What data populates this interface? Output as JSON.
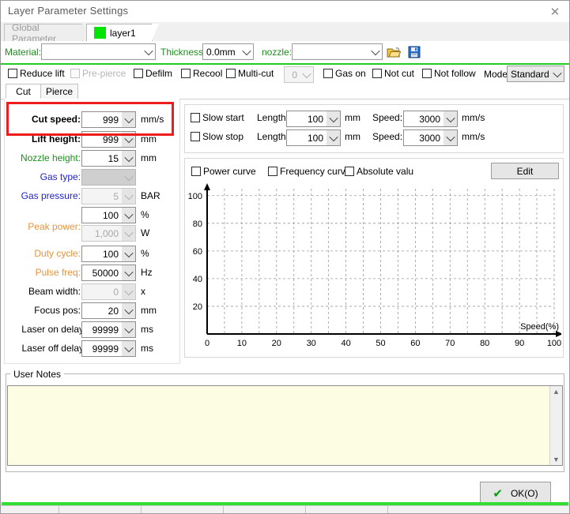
{
  "window": {
    "title": "Layer Parameter Settings",
    "close_icon": "close-icon"
  },
  "param_tabs": [
    {
      "label": "Global Parameter",
      "active": false
    },
    {
      "label": "layer1",
      "active": true,
      "swatch_color": "#00e400"
    }
  ],
  "material_row": {
    "material_label": "Material:",
    "material_value": "",
    "thickness_label": "Thickness:",
    "thickness_value": "0.0mm",
    "nozzle_label": "nozzle:",
    "nozzle_value": "",
    "open_icon": "folder-open-icon",
    "save_icon": "save-disk-icon"
  },
  "options_row": {
    "checkboxes": [
      {
        "label": "Reduce lift",
        "checked": false,
        "disabled": false
      },
      {
        "label": "Pre-pierce",
        "checked": false,
        "disabled": true
      },
      {
        "label": "Defilm",
        "checked": false,
        "disabled": false
      },
      {
        "label": "Recool",
        "checked": false,
        "disabled": false
      },
      {
        "label": "Multi-cut",
        "checked": false,
        "disabled": false
      }
    ],
    "multicut_count": "0",
    "checkboxes2": [
      {
        "label": "Gas on",
        "checked": false,
        "disabled": false
      },
      {
        "label": "Not cut",
        "checked": false,
        "disabled": false
      },
      {
        "label": "Not follow",
        "checked": false,
        "disabled": false
      }
    ],
    "mode_label": "Mode:",
    "mode_value": "Standard"
  },
  "sub_tabs": [
    {
      "label": "Cut",
      "active": true
    },
    {
      "label": "Pierce",
      "active": false
    }
  ],
  "parameters": [
    {
      "label": "Cut speed:",
      "value": "999",
      "unit": "mm/s",
      "style": "bold",
      "state": "normal",
      "highlighted": true
    },
    {
      "label": "Lift height:",
      "value": "999",
      "unit": "mm",
      "style": "bold",
      "state": "normal",
      "highlighted": false
    },
    {
      "label": "Nozzle height:",
      "value": "15",
      "unit": "mm",
      "style": "green",
      "state": "normal",
      "highlighted": false
    },
    {
      "label": "Gas type:",
      "value": "",
      "unit": "",
      "style": "blue",
      "state": "off",
      "highlighted": false
    },
    {
      "label": "Gas pressure:",
      "value": "5",
      "unit": "BAR",
      "style": "blue",
      "state": "disabled",
      "highlighted": false
    },
    {
      "label": "",
      "value": "100",
      "unit": "%",
      "style": "orange",
      "state": "normal",
      "highlighted": false
    },
    {
      "label": "Peak power:",
      "value": "1,000",
      "unit": "W",
      "style": "orange",
      "state": "disabled",
      "highlighted": false
    },
    {
      "label": "Duty cycle:",
      "value": "100",
      "unit": "%",
      "style": "orange",
      "state": "normal",
      "highlighted": false
    },
    {
      "label": "Pulse freq:",
      "value": "50000",
      "unit": "Hz",
      "style": "orange",
      "state": "normal",
      "highlighted": false
    },
    {
      "label": "Beam width:",
      "value": "0",
      "unit": "x",
      "style": "plain",
      "state": "disabled",
      "highlighted": false
    },
    {
      "label": "Focus pos:",
      "value": "20",
      "unit": "mm",
      "style": "plain",
      "state": "normal",
      "highlighted": false
    },
    {
      "label": "Laser on delay",
      "value": "99999",
      "unit": "ms",
      "style": "plain",
      "state": "normal",
      "highlighted": false
    },
    {
      "label": "Laser off delay",
      "value": "99999",
      "unit": "ms",
      "style": "plain",
      "state": "normal",
      "highlighted": false
    }
  ],
  "slow_panel": {
    "rows": [
      {
        "check_label": "Slow start",
        "checked": false,
        "length_label": "Length:",
        "length_value": "100",
        "length_unit": "mm",
        "speed_label": "Speed:",
        "speed_value": "3000",
        "speed_unit": "mm/s"
      },
      {
        "check_label": "Slow stop",
        "checked": false,
        "length_label": "Length:",
        "length_value": "100",
        "length_unit": "mm",
        "speed_label": "Speed:",
        "speed_value": "3000",
        "speed_unit": "mm/s"
      }
    ]
  },
  "curve_panel": {
    "checkboxes": [
      {
        "label": "Power curve",
        "checked": false
      },
      {
        "label": "Frequency curv",
        "checked": false
      },
      {
        "label": "Absolute valu",
        "checked": false
      }
    ],
    "edit_label": "Edit"
  },
  "chart_data": {
    "type": "line",
    "title": "",
    "xlabel": "Speed(%)",
    "ylabel": "",
    "x_ticks": [
      0,
      10,
      20,
      30,
      40,
      50,
      60,
      70,
      80,
      90,
      100
    ],
    "y_ticks": [
      20,
      40,
      60,
      80,
      100
    ],
    "xlim": [
      0,
      100
    ],
    "ylim": [
      0,
      105
    ],
    "grid": true,
    "legend": "none",
    "series": [
      {
        "name": "power curve",
        "x": [],
        "values": []
      }
    ]
  },
  "notes": {
    "legend": "User Notes",
    "value": "",
    "scroll_up_icon": "chevron-up-icon",
    "scroll_down_icon": "chevron-down-icon"
  },
  "footer": {
    "ok_label": "OK(O)",
    "ok_icon": "check-icon",
    "progress_color": "#33dd33"
  }
}
